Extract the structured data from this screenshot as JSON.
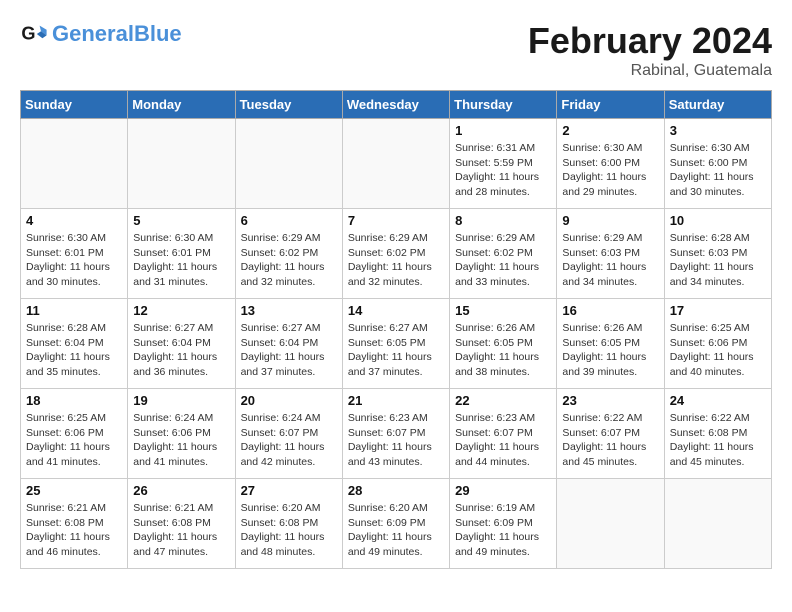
{
  "header": {
    "logo_general": "General",
    "logo_blue": "Blue",
    "month_title": "February 2024",
    "location": "Rabinal, Guatemala"
  },
  "weekdays": [
    "Sunday",
    "Monday",
    "Tuesday",
    "Wednesday",
    "Thursday",
    "Friday",
    "Saturday"
  ],
  "weeks": [
    [
      {
        "day": "",
        "info": ""
      },
      {
        "day": "",
        "info": ""
      },
      {
        "day": "",
        "info": ""
      },
      {
        "day": "",
        "info": ""
      },
      {
        "day": "1",
        "info": "Sunrise: 6:31 AM\nSunset: 5:59 PM\nDaylight: 11 hours\nand 28 minutes."
      },
      {
        "day": "2",
        "info": "Sunrise: 6:30 AM\nSunset: 6:00 PM\nDaylight: 11 hours\nand 29 minutes."
      },
      {
        "day": "3",
        "info": "Sunrise: 6:30 AM\nSunset: 6:00 PM\nDaylight: 11 hours\nand 30 minutes."
      }
    ],
    [
      {
        "day": "4",
        "info": "Sunrise: 6:30 AM\nSunset: 6:01 PM\nDaylight: 11 hours\nand 30 minutes."
      },
      {
        "day": "5",
        "info": "Sunrise: 6:30 AM\nSunset: 6:01 PM\nDaylight: 11 hours\nand 31 minutes."
      },
      {
        "day": "6",
        "info": "Sunrise: 6:29 AM\nSunset: 6:02 PM\nDaylight: 11 hours\nand 32 minutes."
      },
      {
        "day": "7",
        "info": "Sunrise: 6:29 AM\nSunset: 6:02 PM\nDaylight: 11 hours\nand 32 minutes."
      },
      {
        "day": "8",
        "info": "Sunrise: 6:29 AM\nSunset: 6:02 PM\nDaylight: 11 hours\nand 33 minutes."
      },
      {
        "day": "9",
        "info": "Sunrise: 6:29 AM\nSunset: 6:03 PM\nDaylight: 11 hours\nand 34 minutes."
      },
      {
        "day": "10",
        "info": "Sunrise: 6:28 AM\nSunset: 6:03 PM\nDaylight: 11 hours\nand 34 minutes."
      }
    ],
    [
      {
        "day": "11",
        "info": "Sunrise: 6:28 AM\nSunset: 6:04 PM\nDaylight: 11 hours\nand 35 minutes."
      },
      {
        "day": "12",
        "info": "Sunrise: 6:27 AM\nSunset: 6:04 PM\nDaylight: 11 hours\nand 36 minutes."
      },
      {
        "day": "13",
        "info": "Sunrise: 6:27 AM\nSunset: 6:04 PM\nDaylight: 11 hours\nand 37 minutes."
      },
      {
        "day": "14",
        "info": "Sunrise: 6:27 AM\nSunset: 6:05 PM\nDaylight: 11 hours\nand 37 minutes."
      },
      {
        "day": "15",
        "info": "Sunrise: 6:26 AM\nSunset: 6:05 PM\nDaylight: 11 hours\nand 38 minutes."
      },
      {
        "day": "16",
        "info": "Sunrise: 6:26 AM\nSunset: 6:05 PM\nDaylight: 11 hours\nand 39 minutes."
      },
      {
        "day": "17",
        "info": "Sunrise: 6:25 AM\nSunset: 6:06 PM\nDaylight: 11 hours\nand 40 minutes."
      }
    ],
    [
      {
        "day": "18",
        "info": "Sunrise: 6:25 AM\nSunset: 6:06 PM\nDaylight: 11 hours\nand 41 minutes."
      },
      {
        "day": "19",
        "info": "Sunrise: 6:24 AM\nSunset: 6:06 PM\nDaylight: 11 hours\nand 41 minutes."
      },
      {
        "day": "20",
        "info": "Sunrise: 6:24 AM\nSunset: 6:07 PM\nDaylight: 11 hours\nand 42 minutes."
      },
      {
        "day": "21",
        "info": "Sunrise: 6:23 AM\nSunset: 6:07 PM\nDaylight: 11 hours\nand 43 minutes."
      },
      {
        "day": "22",
        "info": "Sunrise: 6:23 AM\nSunset: 6:07 PM\nDaylight: 11 hours\nand 44 minutes."
      },
      {
        "day": "23",
        "info": "Sunrise: 6:22 AM\nSunset: 6:07 PM\nDaylight: 11 hours\nand 45 minutes."
      },
      {
        "day": "24",
        "info": "Sunrise: 6:22 AM\nSunset: 6:08 PM\nDaylight: 11 hours\nand 45 minutes."
      }
    ],
    [
      {
        "day": "25",
        "info": "Sunrise: 6:21 AM\nSunset: 6:08 PM\nDaylight: 11 hours\nand 46 minutes."
      },
      {
        "day": "26",
        "info": "Sunrise: 6:21 AM\nSunset: 6:08 PM\nDaylight: 11 hours\nand 47 minutes."
      },
      {
        "day": "27",
        "info": "Sunrise: 6:20 AM\nSunset: 6:08 PM\nDaylight: 11 hours\nand 48 minutes."
      },
      {
        "day": "28",
        "info": "Sunrise: 6:20 AM\nSunset: 6:09 PM\nDaylight: 11 hours\nand 49 minutes."
      },
      {
        "day": "29",
        "info": "Sunrise: 6:19 AM\nSunset: 6:09 PM\nDaylight: 11 hours\nand 49 minutes."
      },
      {
        "day": "",
        "info": ""
      },
      {
        "day": "",
        "info": ""
      }
    ]
  ]
}
